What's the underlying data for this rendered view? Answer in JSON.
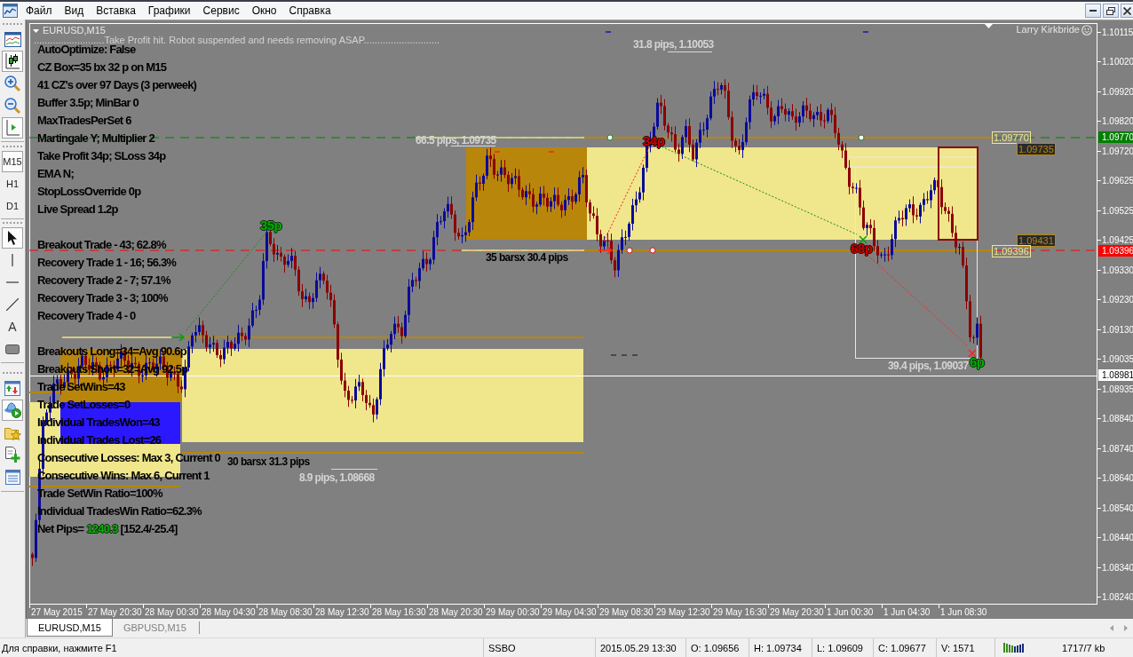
{
  "menu_bar": {
    "items": [
      "Файл",
      "Вид",
      "Вставка",
      "Графики",
      "Сервис",
      "Окно",
      "Справка"
    ]
  },
  "left_toolbar": {
    "chart_tools": [
      {
        "kind": "chart-window",
        "selected": false
      },
      {
        "kind": "candles",
        "selected": true
      },
      {
        "kind": "zoom-in",
        "selected": false
      },
      {
        "kind": "zoom-out",
        "selected": false
      },
      {
        "kind": "chart-shift",
        "selected": true
      }
    ],
    "timeframes": [
      {
        "label": "M15",
        "selected": true
      },
      {
        "label": "H1",
        "selected": false
      },
      {
        "label": "D1",
        "selected": false
      }
    ],
    "drawing_tools": [
      {
        "kind": "cursor",
        "selected": true
      },
      {
        "kind": "vertical-line",
        "selected": false
      },
      {
        "kind": "horizontal-line",
        "selected": false
      },
      {
        "kind": "trend-line",
        "selected": false
      },
      {
        "kind": "text",
        "label": "A",
        "selected": false
      },
      {
        "kind": "rectangle",
        "selected": false
      }
    ],
    "panels": [
      {
        "kind": "market-watch",
        "selected": false
      },
      {
        "kind": "experts",
        "selected": true
      },
      {
        "kind": "favorites",
        "selected": false
      },
      {
        "kind": "new-order",
        "selected": false
      },
      {
        "kind": "terminal",
        "selected": false
      }
    ]
  },
  "chart": {
    "title": "EURUSD,M15",
    "robot_message": "..........................Take Profit hit. Robot suspended and needs removing ASAP............................",
    "author": "Larry Kirkbride",
    "settings": [
      "AutoOptimize: False",
      "CZ Box=35 bx 32 p on M15",
      "41 CZ's over 97 Days (3 perweek)",
      "Buffer 3.5p; MinBar 0",
      "MaxTradesPerSet 6",
      "Martingale Y; Multiplier 2",
      "Take Profit 34p; SLoss 34p",
      "EMA N;",
      "StopLossOverride 0p",
      "Live Spread 1.2p"
    ],
    "trade_breakdown": [
      "Breakout Trade - 43; 62.8%",
      "Recovery Trade 1 - 16; 56.3%",
      "Recovery Trade 2 - 7; 57.1%",
      "Recovery Trade 3 - 3; 100%",
      "Recovery Trade 4 - 0"
    ],
    "results": [
      "Breakouts Long=34=Avg 90.6p",
      "Breakouts Short=32=Avg 92.5p",
      "Trade SetWins=43",
      "Trade SetLosses=0",
      "Individual TradesWon=43",
      "Individual Trades Lost=26",
      "Consecutive Losses: Max 3, Current 0",
      "Consecutive Wins: Max 6, Current 1",
      "Trade SetWin Ratio=100%",
      "Individual TradesWin Ratio=62.3%"
    ],
    "net_pips": {
      "label": "Net Pips=",
      "value": "1240.3",
      "detail": "[152.4/-25.4]"
    },
    "labels": [
      {
        "text": "35p",
        "kind": "profit"
      },
      {
        "text": "34p",
        "kind": "loss"
      },
      {
        "text": "68p",
        "kind": "loss"
      },
      {
        "text": "6p",
        "kind": "profit"
      },
      {
        "text": "66.5 pips, 1.09735",
        "kind": "measure"
      },
      {
        "text": "31.8 pips, 1.10053",
        "kind": "measure"
      },
      {
        "text": "35 barsx 30.4 pips",
        "kind": "stats"
      },
      {
        "text": "39.4 pips, 1.09037",
        "kind": "measure"
      },
      {
        "text": "8.9 pips, 1.08668",
        "kind": "measure"
      },
      {
        "text": "30 barsx 31.3 pips",
        "kind": "stats"
      }
    ],
    "price_tags": [
      {
        "text": "1.09770",
        "color": "#f0e68c"
      },
      {
        "text": "1.09735",
        "color": "#b8860b"
      },
      {
        "text": "1.09431",
        "color": "#b8860b"
      },
      {
        "text": "1.09396",
        "color": "#f0e68c"
      }
    ],
    "price_axis": {
      "ticks": [
        "1.10115",
        "1.10020",
        "1.09920",
        "1.09820",
        "1.09720",
        "1.09625",
        "1.09525",
        "1.09425",
        "1.09330",
        "1.09230",
        "1.09130",
        "1.09035",
        "1.08935",
        "1.08840",
        "1.08740",
        "1.08640",
        "1.08540",
        "1.08440",
        "1.08340",
        "1.08240"
      ],
      "markers": [
        {
          "text": "1.09770",
          "color": "#008000"
        },
        {
          "text": "1.09396",
          "color": "#ff0000"
        },
        {
          "text": "1.08981",
          "color": "#ffffff"
        }
      ]
    },
    "time_axis": [
      "27 May 2015",
      "27 May 20:30",
      "28 May 00:30",
      "28 May 04:30",
      "28 May 08:30",
      "28 May 12:30",
      "28 May 16:30",
      "28 May 20:30",
      "29 May 00:30",
      "29 May 04:30",
      "29 May 08:30",
      "29 May 12:30",
      "29 May 16:30",
      "29 May 20:30",
      "1 Jun 00:30",
      "1 Jun 04:30",
      "1 Jun 08:30"
    ]
  },
  "tabs": [
    {
      "label": "EURUSD,M15",
      "selected": true
    },
    {
      "label": "GBPUSD,M15",
      "selected": false
    }
  ],
  "status_bar": {
    "help": "Для справки, нажмите F1",
    "profile": "SSBO",
    "datetime": "2015.05.29 13:30",
    "open": "O: 1.09656",
    "high": "H: 1.09734",
    "low": "L: 1.09609",
    "close": "C: 1.09677",
    "volume": "V: 1571",
    "traffic": "1717/7 kb"
  }
}
